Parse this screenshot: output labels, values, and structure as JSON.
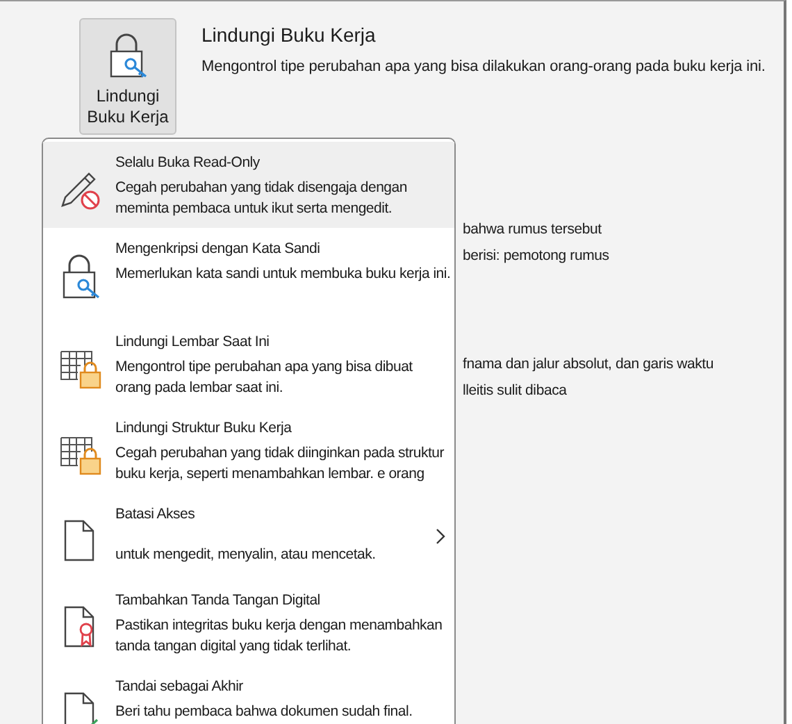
{
  "protect_button": {
    "label": "Lindungi Buku Kerja"
  },
  "heading": "Lindungi Buku Kerja",
  "description": "Mengontrol tipe perubahan apa yang bisa dilakukan orang-orang pada buku kerja ini.",
  "background_lines": [
    "bahwa rumus tersebut",
    "berisi: pemotong rumus",
    "fnama dan jalur absolut, dan garis waktu",
    "lleitis sulit dibaca"
  ],
  "menu": {
    "items": [
      {
        "kind": "read-only",
        "title": "Selalu Buka Read-Only",
        "description": [
          "Cegah perubahan yang tidak disengaja dengan",
          "meminta pembaca untuk ikut serta mengedit."
        ],
        "selected": true,
        "has_submenu": false
      },
      {
        "kind": "encrypt",
        "title": "Mengenkripsi dengan Kata Sandi",
        "description": [
          "Memerlukan kata sandi untuk membuka buku kerja ini."
        ],
        "selected": false,
        "has_submenu": false
      },
      {
        "kind": "sheet",
        "title": "Lindungi Lembar Saat Ini",
        "description": [
          "Mengontrol tipe perubahan apa yang bisa dibuat",
          "orang pada lembar saat ini."
        ],
        "selected": false,
        "has_submenu": false
      },
      {
        "kind": "sheet",
        "title": "Lindungi Struktur Buku Kerja",
        "description": [
          "Cegah perubahan yang tidak diinginkan pada struktur",
          "buku kerja, seperti menambahkan lembar. e orang"
        ],
        "selected": false,
        "has_submenu": false
      },
      {
        "kind": "document",
        "title": "Batasi Akses",
        "description": [
          "untuk mengedit, menyalin, atau mencetak."
        ],
        "selected": false,
        "has_submenu": true
      },
      {
        "kind": "signature",
        "title": "Tambahkan Tanda Tangan Digital",
        "description": [
          "Pastikan integritas buku kerja dengan menambahkan",
          "tanda tangan digital yang tidak terlihat."
        ],
        "selected": false,
        "has_submenu": false
      },
      {
        "kind": "final",
        "title": "Tandai sebagai Akhir",
        "description": [
          "Beri tahu pembaca bahwa dokumen sudah final."
        ],
        "selected": false,
        "has_submenu": false
      }
    ]
  }
}
